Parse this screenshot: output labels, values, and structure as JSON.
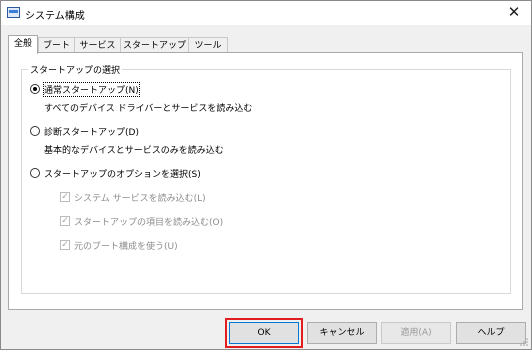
{
  "window": {
    "title": "システム構成"
  },
  "tabs": [
    "全般",
    "ブート",
    "サービス",
    "スタートアップ",
    "ツール"
  ],
  "group": {
    "legend": "スタートアップの選択"
  },
  "options": {
    "normal": {
      "label": "通常スタートアップ(N)",
      "desc": "すべてのデバイス ドライバーとサービスを読み込む",
      "checked": true
    },
    "diagnostic": {
      "label": "診断スタートアップ(D)",
      "desc": "基本的なデバイスとサービスのみを読み込む",
      "checked": false
    },
    "selective": {
      "label": "スタートアップのオプションを選択(S)",
      "checked": false
    }
  },
  "checks": [
    "システム サービスを読み込む(L)",
    "スタートアップの項目を読み込む(O)",
    "元のブート構成を使う(U)"
  ],
  "buttons": {
    "ok": "OK",
    "cancel": "キャンセル",
    "apply": "適用(A)",
    "help": "ヘルプ"
  },
  "icons": {
    "close": "close-icon",
    "app": "app-icon"
  },
  "colors": {
    "highlight": "#e01e1e",
    "focus": "#0078d7"
  }
}
